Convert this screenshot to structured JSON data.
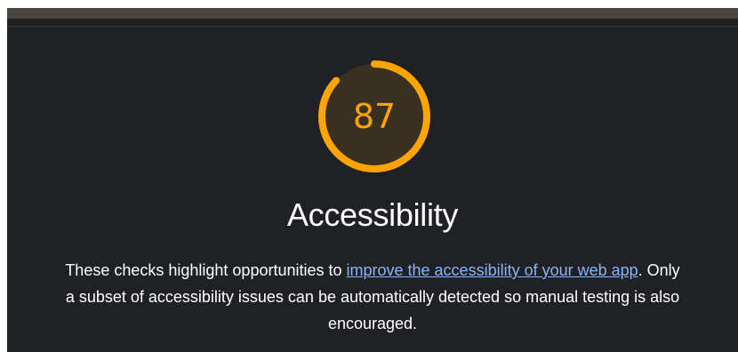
{
  "score": {
    "value": "87",
    "fraction": 0.87,
    "color": "#ffa400",
    "track_color": "#3a3022"
  },
  "category": {
    "title": "Accessibility"
  },
  "description": {
    "text_before": "These checks highlight opportunities to ",
    "link_text": "improve the accessibility of your web app",
    "text_after": ". Only a subset of accessibility issues can be automatically detected so manual testing is also encouraged."
  }
}
